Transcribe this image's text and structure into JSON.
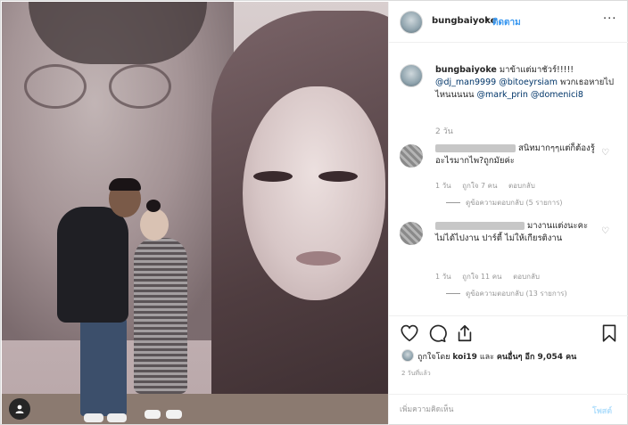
{
  "post": {
    "username": "bungbaiyoke",
    "follow_label": "ติดตาม",
    "more_label": "···"
  },
  "caption": {
    "username": "bungbaiyoke",
    "text_before": "มาข้าแต่มาชัวร์!!!!!",
    "mention1": "@dj_man9999",
    "mention2": "@bitoeyrsiam",
    "text_mid": "พวกเธอหายไปไหนนนนน",
    "mention3": "@mark_prin",
    "mention4": "@domenici8",
    "time": "2 วัน"
  },
  "comments": [
    {
      "text": "สนิทมากๆๆแต่ก็ต้องรู้อะไรมากไพ?ถูกมัยค่ะ",
      "time": "1 วัน",
      "likes": "ถูกใจ 7 คน",
      "reply": "ตอบกลับ",
      "view_replies": "ดูข้อความตอบกลับ (5 รายการ)"
    },
    {
      "text": "มางานแต่งนะคะ ไม่ได้ไปงาน ปาร์ตี้ ไม่ให้เกียรติงาน",
      "time": "1 วัน",
      "likes": "ถูกใจ 11 คน",
      "reply": "ตอบกลับ",
      "view_replies": "ดูข้อความตอบกลับ (13 รายการ)"
    }
  ],
  "likes": {
    "prefix": "ถูกใจโดย",
    "user": "koi19",
    "middle": "และ",
    "others": "คนอื่นๆ อีก 9,054 คน"
  },
  "post_time": "2 วันที่แล้ว",
  "add_comment": {
    "placeholder": "เพิ่มความคิดเห็น",
    "post_label": "โพสต์"
  },
  "icons": [
    "user-tag-icon",
    "more-icon",
    "heart-icon",
    "comment-icon",
    "share-icon",
    "bookmark-icon"
  ],
  "colors": {
    "link": "#003569",
    "follow": "#3897f0",
    "muted": "#999999",
    "post_disabled": "#b2dffc"
  }
}
